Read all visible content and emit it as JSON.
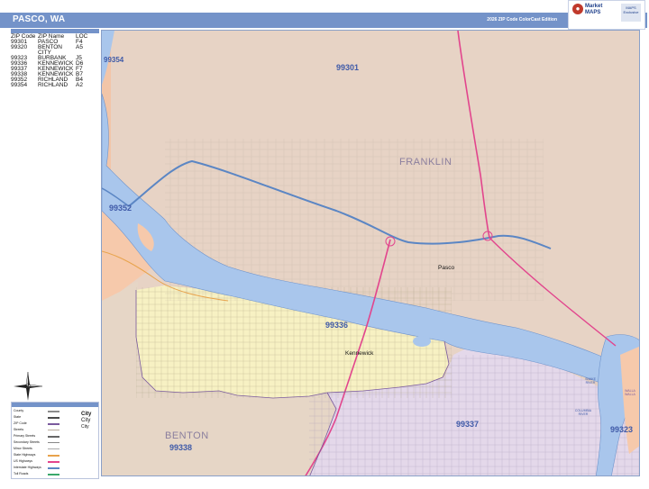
{
  "header": {
    "title": "PASCO, WA",
    "edition": "2026 ZIP Code ColorCast Edition"
  },
  "logo": {
    "brand_line1": "Market",
    "brand_line2": "MAPS",
    "badge": "MAPS Exclusive"
  },
  "zip_index": {
    "columns": [
      "ZIP Code",
      "ZIP Name",
      "LOC"
    ],
    "rows": [
      {
        "zip": "99301",
        "name": "PASCO",
        "loc": "F4"
      },
      {
        "zip": "99320",
        "name": "BENTON CITY",
        "loc": "A5"
      },
      {
        "zip": "99323",
        "name": "BURBANK",
        "loc": "J5"
      },
      {
        "zip": "99336",
        "name": "KENNEWICK",
        "loc": "D6"
      },
      {
        "zip": "99337",
        "name": "KENNEWICK",
        "loc": "F7"
      },
      {
        "zip": "99338",
        "name": "KENNEWICK",
        "loc": "B7"
      },
      {
        "zip": "99352",
        "name": "RICHLAND",
        "loc": "B4"
      },
      {
        "zip": "99354",
        "name": "RICHLAND",
        "loc": "A2"
      }
    ]
  },
  "map_labels": {
    "zip_99301": "99301",
    "zip_99354": "99354",
    "zip_99352": "99352",
    "zip_99336": "99336",
    "zip_99337": "99337",
    "zip_99338": "99338",
    "zip_99323": "99323",
    "county_franklin": "FRANKLIN",
    "county_benton": "BENTON",
    "city_pasco": "Pasco",
    "city_kennewick": "Kennewick",
    "river_snake": "SNAKE RIVER",
    "river_columbia": "COLUMBIA RIVER",
    "county_walla_walla": "WALLA WALLA"
  },
  "legend": {
    "rows": [
      "County",
      "State",
      "ZIP Code",
      "Streets",
      "Primary Streets",
      "Secondary Streets",
      "Minor Streets",
      "State Highways",
      "US Highways",
      "Interstate Highways",
      "Toll Roads"
    ],
    "city_samples": [
      "City",
      "City",
      "City"
    ]
  },
  "colors": {
    "title_bar": "#7493c9",
    "zip_99301": "#e7d3c5",
    "zip_99336": "#f7f1c3",
    "zip_99337": "#e4d8ea",
    "zip_99352": "#f6c9ab",
    "zip_99338": "#e6d6c6",
    "water": "#a9c6ec",
    "interstate": "#5b86c4",
    "us_highway": "#e2458d"
  }
}
